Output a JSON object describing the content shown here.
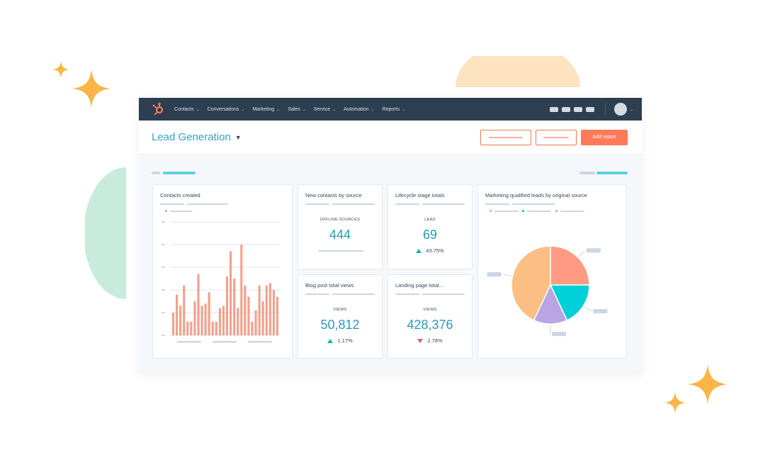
{
  "nav": {
    "items": [
      {
        "label": "Contacts"
      },
      {
        "label": "Conversations"
      },
      {
        "label": "Marketing"
      },
      {
        "label": "Sales"
      },
      {
        "label": "Service"
      },
      {
        "label": "Automation"
      },
      {
        "label": "Reports"
      }
    ]
  },
  "header": {
    "title": "Lead Generation",
    "primary_button": "Add report"
  },
  "cards": {
    "contacts_created": {
      "title": "Contacts created"
    },
    "new_contacts": {
      "title": "New contacts by source",
      "label": "OFFLINE SOURCES",
      "value": "444"
    },
    "lifecycle": {
      "title": "Lifecycle stage totals",
      "label": "LEAD",
      "value": "69",
      "change": "43.75%",
      "direction": "up"
    },
    "blog_views": {
      "title": "Blog post total views",
      "label": "VIEWS",
      "value": "50,812",
      "change": "1.17%",
      "direction": "up"
    },
    "landing_views": {
      "title": "Landing page total...",
      "label": "VIEWS",
      "value": "428,376",
      "change": "2.78%",
      "direction": "down"
    },
    "mql": {
      "title": "Marketing qualified leads by original source"
    }
  },
  "colors": {
    "nav_bg": "#2d3e50",
    "brand_orange": "#ff7a59",
    "title_blue": "#33a3c3",
    "value_teal": "#2c9ab7",
    "bar_salmon": "#f3a08c",
    "up_green": "#00bda5",
    "down_red": "#f2545b"
  },
  "chart_data": [
    {
      "type": "bar",
      "title": "Contacts created",
      "ylim": [
        0,
        50
      ],
      "grid": true,
      "values": [
        10,
        18,
        13,
        22,
        6,
        6,
        15,
        27,
        13,
        14,
        19,
        6,
        6,
        12,
        13,
        26,
        37,
        25,
        12,
        40,
        22,
        17,
        6,
        11,
        22,
        15,
        22,
        23,
        20,
        17
      ]
    },
    {
      "type": "pie",
      "title": "Marketing qualified leads by original source",
      "slices": [
        {
          "value": 25,
          "color": "#ff9b82"
        },
        {
          "value": 18,
          "color": "#00d0d8"
        },
        {
          "value": 14,
          "color": "#b9a4e4"
        },
        {
          "value": 43,
          "color": "#fbbf84"
        }
      ]
    }
  ]
}
